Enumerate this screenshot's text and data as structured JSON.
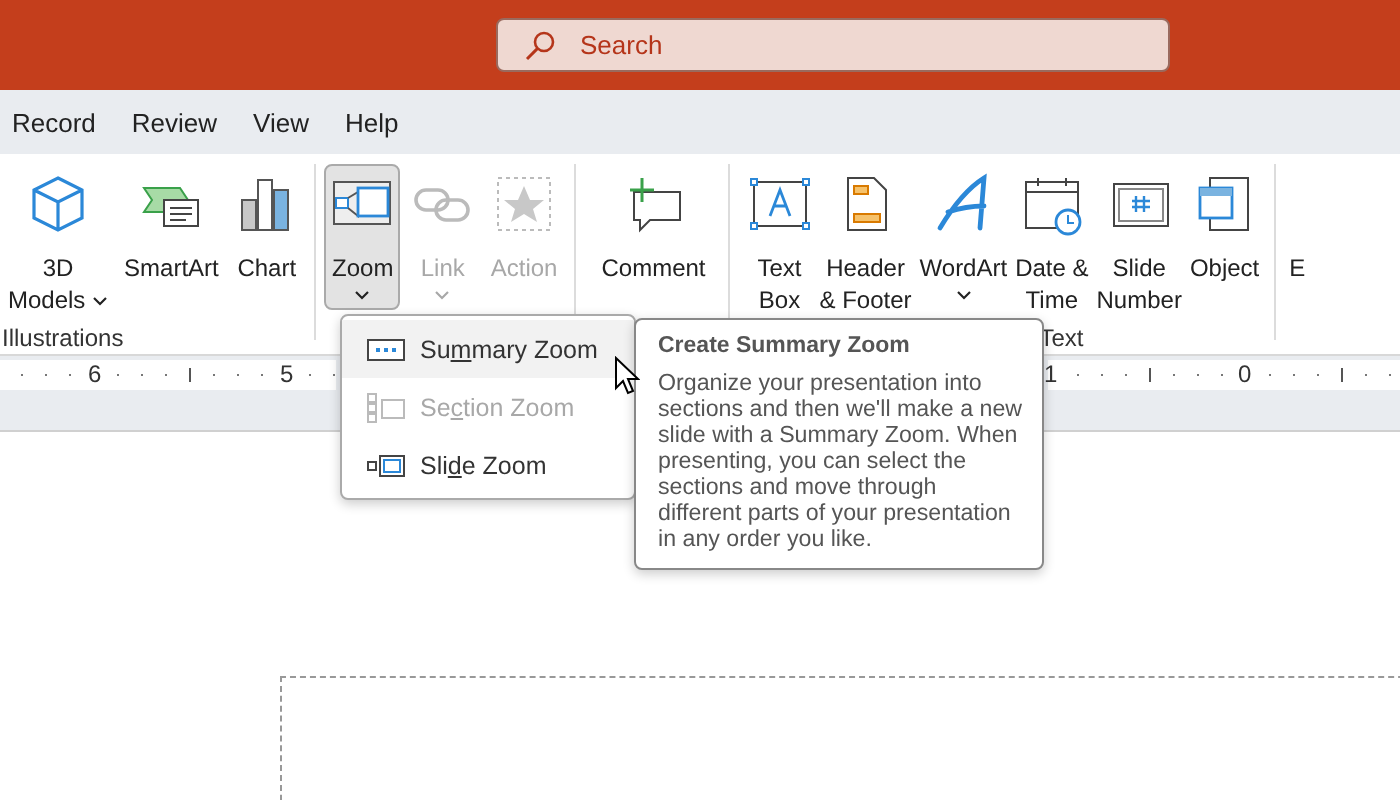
{
  "title_bar": {
    "search": {
      "placeholder": "Search"
    }
  },
  "tabs": [
    {
      "label": "Record",
      "selected": false
    },
    {
      "label": "Review",
      "selected": false
    },
    {
      "label": "View",
      "selected": false
    },
    {
      "label": "Help",
      "selected": false
    }
  ],
  "ribbon": {
    "groups": [
      {
        "label": "Illustrations",
        "items": [
          {
            "label_lines": [
              "3D",
              "Models"
            ],
            "dropdown": true,
            "disabled": false,
            "selected": false
          },
          {
            "label_lines": [
              "SmartArt"
            ],
            "disabled": false,
            "selected": false
          },
          {
            "label_lines": [
              "Chart"
            ],
            "disabled": false,
            "selected": false
          }
        ]
      },
      {
        "items": [
          {
            "label_lines": [
              "Zoom"
            ],
            "dropdown": true,
            "disabled": false,
            "selected": true
          },
          {
            "label_lines": [
              "Link"
            ],
            "dropdown": true,
            "disabled": true,
            "selected": false
          },
          {
            "label_lines": [
              "Action"
            ],
            "disabled": true,
            "selected": false
          }
        ]
      },
      {
        "items": [
          {
            "label_lines": [
              "Comment"
            ],
            "disabled": false,
            "selected": false
          }
        ]
      },
      {
        "label": "Text",
        "items": [
          {
            "label_lines": [
              "Text",
              "Box"
            ],
            "disabled": false,
            "selected": false
          },
          {
            "label_lines": [
              "Header",
              "& Footer"
            ],
            "disabled": false,
            "selected": false
          },
          {
            "label_lines": [
              "WordArt"
            ],
            "dropdown": true,
            "disabled": false,
            "selected": false
          },
          {
            "label_lines": [
              "Date &",
              "Time"
            ],
            "disabled": false,
            "selected": false
          },
          {
            "label_lines": [
              "Slide",
              "Number"
            ],
            "disabled": false,
            "selected": false
          },
          {
            "label_lines": [
              "Object"
            ],
            "disabled": false,
            "selected": false
          }
        ]
      },
      {
        "items": [
          {
            "label_lines": [
              "E"
            ],
            "disabled": false,
            "selected": false
          }
        ]
      }
    ]
  },
  "ruler": {
    "labels": [
      "6",
      "5",
      "1",
      "0"
    ]
  },
  "zoom_menu": {
    "items": [
      {
        "label_start": "Su",
        "access_key": "m",
        "label_end": "mary Zoom",
        "selected": true,
        "disabled": false
      },
      {
        "label_start": "Se",
        "access_key": "c",
        "label_end": "tion Zoom",
        "selected": false,
        "disabled": true
      },
      {
        "label_start": "Sli",
        "access_key": "d",
        "label_end": "e Zoom",
        "selected": false,
        "disabled": false
      }
    ]
  },
  "tooltip": {
    "title": "Create Summary Zoom",
    "body": "Organize your presentation into sections and then we'll make a new slide with a Summary Zoom. When presenting, you can select the sections and move through different parts of your presentation in any order you like."
  }
}
